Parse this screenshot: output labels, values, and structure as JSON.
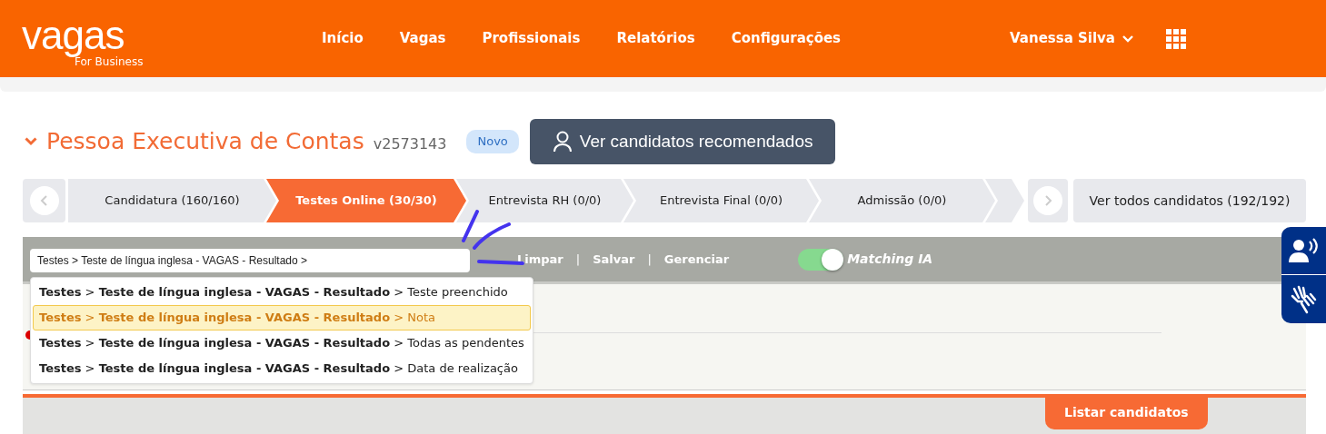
{
  "header": {
    "logo": "vagas",
    "logo_subtitle": "For Business",
    "nav": [
      {
        "label": "Início"
      },
      {
        "label": "Vagas"
      },
      {
        "label": "Profissionais"
      },
      {
        "label": "Relatórios"
      },
      {
        "label": "Configurações"
      }
    ],
    "user": "Vanessa Silva"
  },
  "job": {
    "title": "Pessoa Executiva de Contas",
    "code": "v2573143",
    "badge": "Novo",
    "recommend_button": "Ver candidatos recomendados"
  },
  "steps": [
    {
      "label": "Candidatura (160/160)",
      "selected": false
    },
    {
      "label": "Testes Online (30/30)",
      "selected": true
    },
    {
      "label": "Entrevista RH (0/0)",
      "selected": false
    },
    {
      "label": "Entrevista Final (0/0)",
      "selected": false
    },
    {
      "label": "Admissão (0/0)",
      "selected": false
    }
  ],
  "all_candidates": "Ver todos candidatos (192/192)",
  "filter": {
    "value": "Testes > Teste de língua inglesa - VAGAS - Resultado >",
    "actions": [
      "Limpar",
      "Salvar",
      "Gerenciar"
    ],
    "separator": "|",
    "toggle": {
      "label": "Matching IA",
      "on": true
    }
  },
  "suggestions": [
    {
      "text": "**Testes** > **Teste de língua inglesa - VAGAS - Resultado** > Teste preenchido",
      "selected": false
    },
    {
      "text": "**Testes** > **Teste de língua inglesa - VAGAS - Resultado** > Nota",
      "selected": true
    },
    {
      "text": "**Testes** > **Teste de língua inglesa - VAGAS - Resultado** > Todas as pendentes",
      "selected": false
    },
    {
      "text": "**Testes** > **Teste de língua inglesa - VAGAS - Resultado** > Data de realização",
      "selected": false
    }
  ],
  "list_button": "Listar candidatos"
}
